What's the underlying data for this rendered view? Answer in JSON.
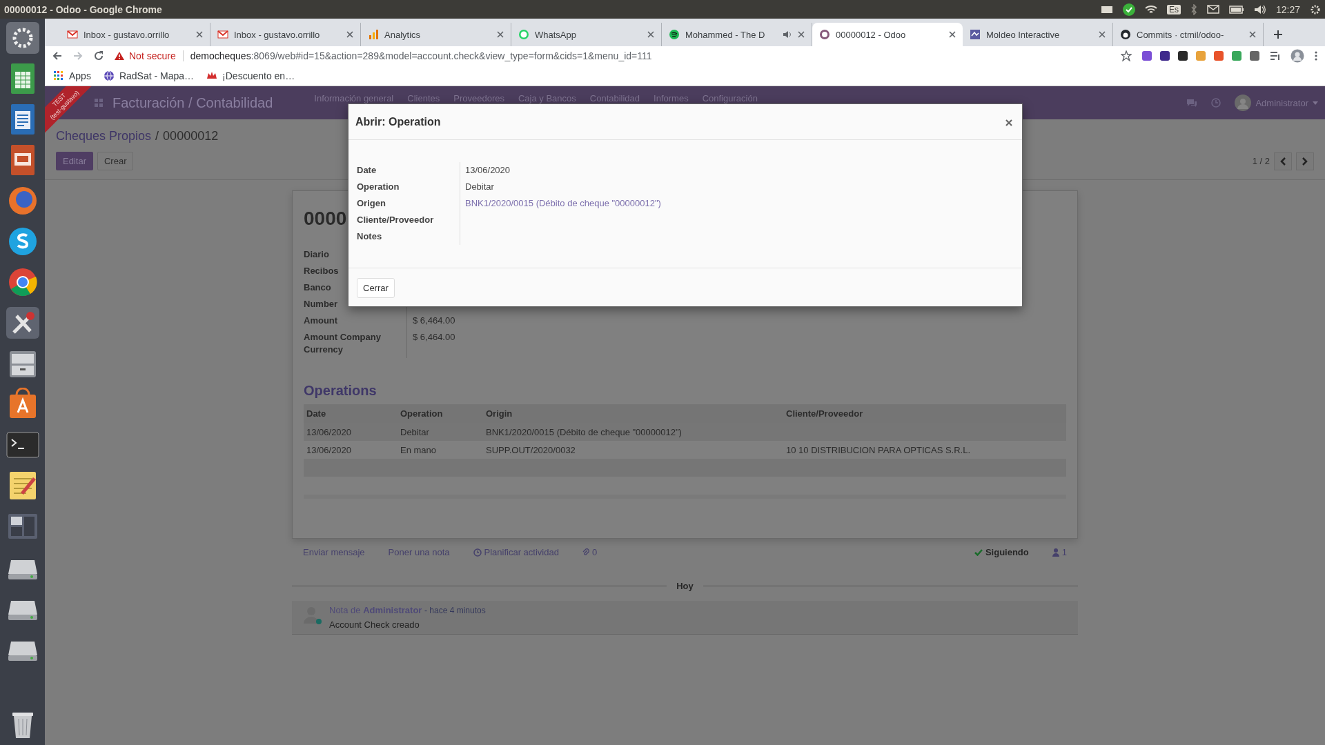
{
  "system_bar": {
    "title": "00000012 - Odoo - Google Chrome",
    "keyboard_layout": "Es",
    "time": "12:27"
  },
  "browser": {
    "tabs": [
      {
        "title": "Inbox - gustavo.orrillo",
        "selected": false,
        "audio": false
      },
      {
        "title": "Inbox - gustavo.orrillo",
        "selected": false,
        "audio": false
      },
      {
        "title": "Analytics",
        "selected": false,
        "audio": false
      },
      {
        "title": "WhatsApp",
        "selected": false,
        "audio": false
      },
      {
        "title": "Mohammed - The D",
        "selected": false,
        "audio": true
      },
      {
        "title": "00000012 - Odoo",
        "selected": true,
        "audio": false
      },
      {
        "title": "Moldeo Interactive",
        "selected": false,
        "audio": false
      },
      {
        "title": "Commits · ctmil/odoo-",
        "selected": false,
        "audio": false
      }
    ],
    "address_bar": {
      "security": "Not secure",
      "host": "democheques",
      "path": ":8069/web#id=15&action=289&model=account.check&view_type=form&cids=1&menu_id=111"
    },
    "bookmarks": [
      "Apps",
      "RadSat - Mapa…",
      "¡Descuento en…"
    ]
  },
  "app": {
    "title": "Facturación / Contabilidad",
    "menu": [
      "Información general",
      "Clientes",
      "Proveedores",
      "Caja y Bancos",
      "Contabilidad",
      "Informes",
      "Configuración"
    ],
    "user": "Administrator",
    "ribbon": [
      "TEST",
      "(test-gustavo)"
    ],
    "breadcrumb": {
      "items": [
        "Cheques Propios",
        "00000012"
      ],
      "separator": "/"
    },
    "buttons": [
      "Editar",
      "Crear"
    ],
    "pager": "1 / 2",
    "form": {
      "title": "0000",
      "fields": [
        {
          "label": "Diario"
        },
        {
          "label": "Recibos"
        },
        {
          "label": "Banco"
        },
        {
          "label": "Number"
        },
        {
          "label": "Amount",
          "value": "$ 6,464.00"
        },
        {
          "label": "Amount Company Currency",
          "value": "$ 6,464.00"
        }
      ],
      "operations": {
        "title": "Operations",
        "columns": [
          "Date",
          "Operation",
          "Origin",
          "Cliente/Proveedor"
        ],
        "rows": [
          [
            "13/06/2020",
            "Debitar",
            "BNK1/2020/0015 (Débito de cheque \"00000012\")",
            ""
          ],
          [
            "13/06/2020",
            "En mano",
            "SUPP.OUT/2020/0032",
            "10 10 DISTRIBUCION PARA OPTICAS S.R.L."
          ]
        ]
      }
    },
    "chatter": {
      "actions": [
        "Enviar mensaje",
        "Poner una nota",
        "Planificar actividad"
      ],
      "attachments": "0",
      "following": "Siguiendo",
      "followers": "1",
      "separator": "Hoy",
      "messages": [
        {
          "prefix": "Nota de",
          "author": "Administrator",
          "time": "- hace 4 minutos",
          "body": "Account Check creado"
        }
      ]
    }
  },
  "dialog": {
    "title": "Abrir: Operation",
    "fields": [
      {
        "label": "Date",
        "value": "13/06/2020"
      },
      {
        "label": "Operation",
        "value": "Debitar"
      },
      {
        "label": "Origen",
        "value": "BNK1/2020/0015 (Débito de cheque \"00000012\")",
        "kind": "link"
      },
      {
        "label": "Cliente/Proveedor"
      },
      {
        "label": "Notes"
      }
    ],
    "button": "Cerrar"
  }
}
